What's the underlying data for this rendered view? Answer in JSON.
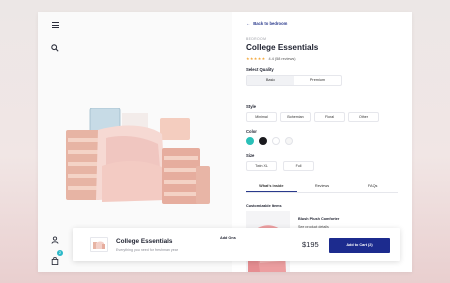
{
  "nav": {
    "back_label": "Back to bedroom"
  },
  "product": {
    "brand": "BEDROOM",
    "title": "College Essentials",
    "rating_text": "4.4 (58 reviews)",
    "stars": "★★★★★"
  },
  "options": {
    "quality_label": "Select Quality",
    "quality": [
      "Basic",
      "Premium"
    ],
    "style_label": "Style",
    "styles": [
      "Minimal",
      "Bohemian",
      "Floral",
      "Other"
    ],
    "color_label": "Color",
    "colors": [
      "#2bc0b8",
      "#1a1a1f",
      "#ffffff",
      "#f6f6f6"
    ],
    "size_label": "Size",
    "sizes": [
      "Twin XL",
      "Full"
    ]
  },
  "tabs": [
    "What's inside",
    "Reviews",
    "FAQs"
  ],
  "customizable": {
    "label": "Customizable Items",
    "item_name": "Blush Plush Comforter",
    "item_link": "See product details"
  },
  "bar": {
    "title": "College Essentials",
    "subtitle": "Everything you need for freshman year",
    "addons_label": "Add Ons",
    "price": "$195",
    "add_button": "Add to Cart (2)"
  },
  "cart_count": "2",
  "icons": [
    "menu-icon",
    "search-icon",
    "user-icon",
    "bag-icon",
    "arrow-left-icon"
  ]
}
